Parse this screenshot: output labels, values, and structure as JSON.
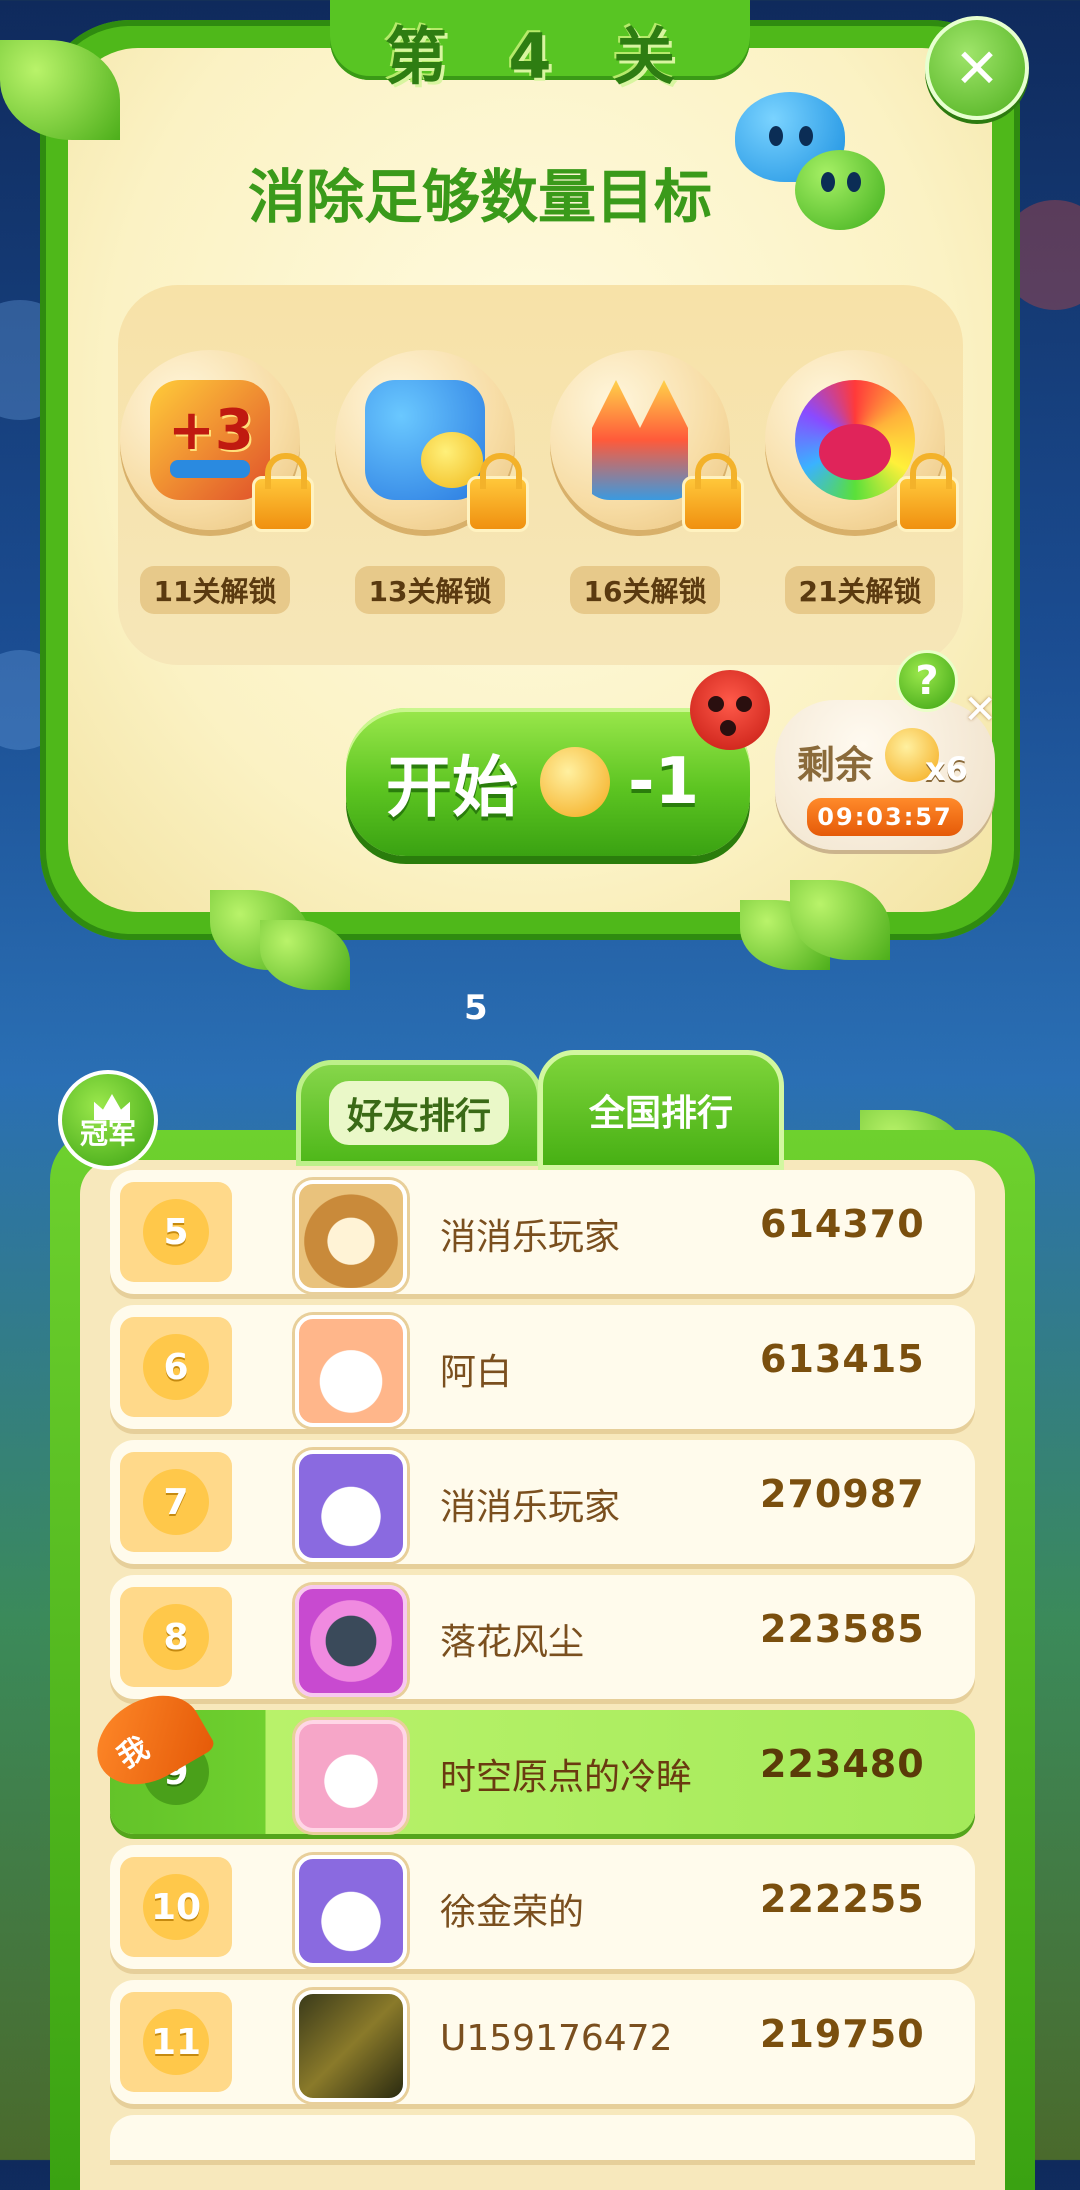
{
  "level": {
    "title": "第 4 关",
    "goal": "消除足够数量目标"
  },
  "boosters": [
    {
      "label": "11关解锁",
      "icon": "plus3-moves-icon"
    },
    {
      "label": "13关解锁",
      "icon": "color-swap-icon"
    },
    {
      "label": "16关解锁",
      "icon": "firework-rocket-icon"
    },
    {
      "label": "21关解锁",
      "icon": "rainbow-bird-icon"
    }
  ],
  "start": {
    "label": "开始",
    "cost": "-1"
  },
  "remaining": {
    "label": "剩余",
    "count": "x6",
    "timer": "09:03:57",
    "help": "?",
    "close": "✕"
  },
  "middle": {
    "number": "5"
  },
  "tabs": {
    "friends": "好友排行",
    "national": "全国排行"
  },
  "champion": {
    "label": "冠军"
  },
  "me_badge": "我",
  "leaderboard": [
    {
      "rank": "5",
      "name": "消消乐玩家",
      "score": "614370",
      "avatar": "raccoon-avatar"
    },
    {
      "rank": "6",
      "name": "阿白",
      "score": "613415",
      "avatar": "puppy-avatar"
    },
    {
      "rank": "7",
      "name": "消消乐玩家",
      "score": "270987",
      "avatar": "bunny-avatar"
    },
    {
      "rank": "8",
      "name": "落花风尘",
      "score": "223585",
      "avatar": "photo-frame-avatar"
    },
    {
      "rank": "9",
      "name": "时空原点的冷眸",
      "score": "223480",
      "avatar": "pig-frame-avatar",
      "is_me": true
    },
    {
      "rank": "10",
      "name": "徐金荣的",
      "score": "222255",
      "avatar": "bunny-avatar"
    },
    {
      "rank": "11",
      "name": "U159176472",
      "score": "219750",
      "avatar": "photo-avatar"
    }
  ],
  "colors": {
    "vine_green": "#4fb81a",
    "panel_cream": "#fbf2c4",
    "accent_orange": "#e55a08"
  }
}
